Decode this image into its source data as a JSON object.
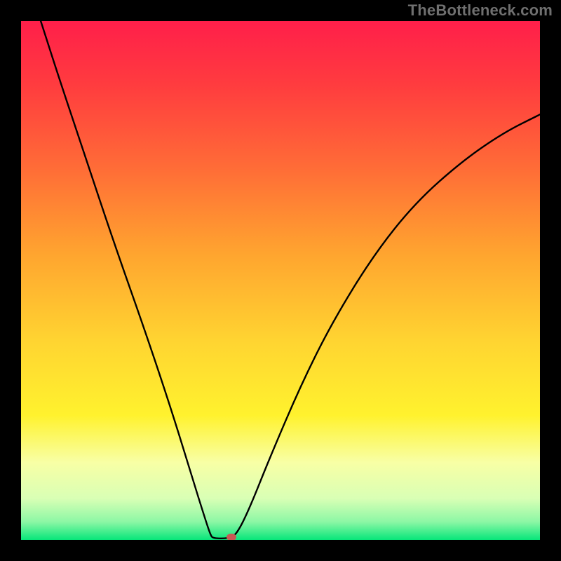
{
  "watermark": "TheBottleneck.com",
  "colors": {
    "frame": "#000000",
    "watermark": "#6f6f6f",
    "curve": "#000000",
    "marker": "#c85a54",
    "gradient_stops": [
      {
        "offset": 0.0,
        "color": "#ff1f4a"
      },
      {
        "offset": 0.12,
        "color": "#ff3b3f"
      },
      {
        "offset": 0.28,
        "color": "#ff6b37"
      },
      {
        "offset": 0.45,
        "color": "#ffa52f"
      },
      {
        "offset": 0.62,
        "color": "#ffd531"
      },
      {
        "offset": 0.76,
        "color": "#fff22e"
      },
      {
        "offset": 0.85,
        "color": "#f8ffa5"
      },
      {
        "offset": 0.92,
        "color": "#d9ffb5"
      },
      {
        "offset": 0.965,
        "color": "#8cf7a5"
      },
      {
        "offset": 1.0,
        "color": "#07e67a"
      }
    ]
  },
  "chart_data": {
    "type": "line",
    "title": "",
    "xlabel": "",
    "ylabel": "",
    "xlim": [
      0,
      100
    ],
    "ylim": [
      0,
      100
    ],
    "grid": false,
    "legend": false,
    "series": [
      {
        "name": "bottleneck-curve",
        "points": [
          {
            "x": 3.8,
            "y": 100.0
          },
          {
            "x": 7.0,
            "y": 90.0
          },
          {
            "x": 12.0,
            "y": 75.0
          },
          {
            "x": 18.0,
            "y": 57.0
          },
          {
            "x": 24.0,
            "y": 40.0
          },
          {
            "x": 29.0,
            "y": 25.0
          },
          {
            "x": 33.0,
            "y": 12.0
          },
          {
            "x": 35.5,
            "y": 4.0
          },
          {
            "x": 36.5,
            "y": 1.0
          },
          {
            "x": 37.0,
            "y": 0.3
          },
          {
            "x": 40.0,
            "y": 0.3
          },
          {
            "x": 41.5,
            "y": 1.0
          },
          {
            "x": 44.0,
            "y": 6.0
          },
          {
            "x": 48.0,
            "y": 16.0
          },
          {
            "x": 54.0,
            "y": 30.0
          },
          {
            "x": 60.0,
            "y": 42.0
          },
          {
            "x": 68.0,
            "y": 55.0
          },
          {
            "x": 76.0,
            "y": 65.0
          },
          {
            "x": 85.0,
            "y": 73.0
          },
          {
            "x": 93.0,
            "y": 78.5
          },
          {
            "x": 100.0,
            "y": 82.0
          }
        ]
      }
    ],
    "markers": [
      {
        "name": "optimal-point",
        "x": 40.5,
        "y": 0.5
      }
    ]
  }
}
